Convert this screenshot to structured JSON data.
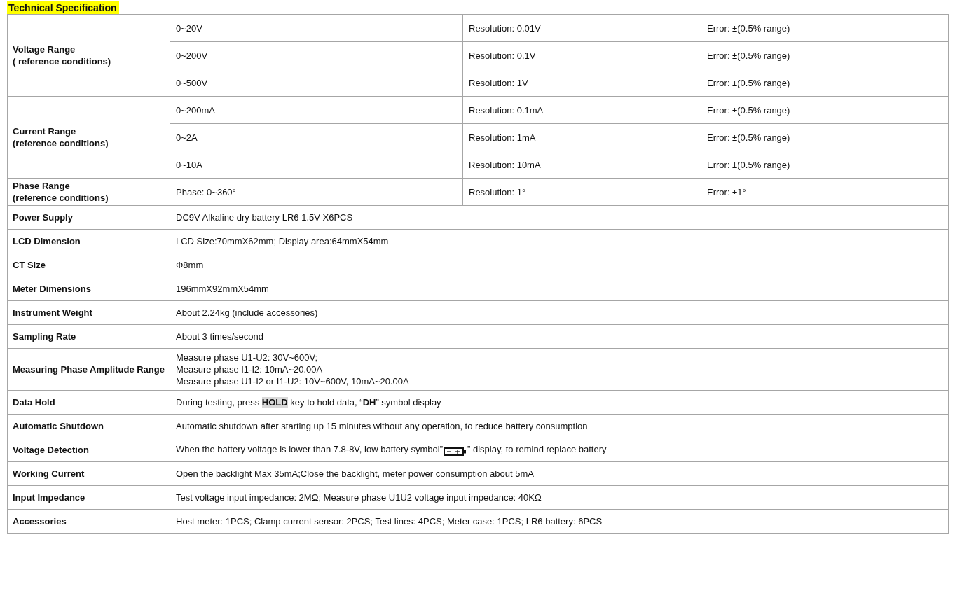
{
  "title": "Technical Specification",
  "rows": [
    {
      "kind": "ranges",
      "label": "Voltage Range\n( reference conditions)",
      "subrows": [
        {
          "range": "0~20V",
          "resolution": "Resolution: 0.01V",
          "error": "Error: ±(0.5% range)"
        },
        {
          "range": "0~200V",
          "resolution": "Resolution: 0.1V",
          "error": "Error: ±(0.5% range)"
        },
        {
          "range": "0~500V",
          "resolution": "Resolution: 1V",
          "error": "Error: ±(0.5% range)"
        }
      ]
    },
    {
      "kind": "ranges",
      "label": "Current Range\n(reference conditions)",
      "subrows": [
        {
          "range": "0~200mA",
          "resolution": "Resolution: 0.1mA",
          "error": "Error: ±(0.5% range)"
        },
        {
          "range": "0~2A",
          "resolution": "Resolution: 1mA",
          "error": "Error: ±(0.5% range)"
        },
        {
          "range": "0~10A",
          "resolution": "Resolution: 10mA",
          "error": "Error: ±(0.5% range)"
        }
      ]
    },
    {
      "kind": "ranges",
      "label": "Phase Range\n(reference conditions)",
      "subrows": [
        {
          "range": "Phase: 0~360°",
          "resolution": "Resolution: 1°",
          "error": "Error: ±1°"
        }
      ]
    },
    {
      "kind": "text",
      "label": "Power Supply",
      "value": "DC9V Alkaline dry battery LR6 1.5V X6PCS"
    },
    {
      "kind": "text",
      "label": "LCD Dimension",
      "value": "LCD Size:70mmX62mm; Display area:64mmX54mm"
    },
    {
      "kind": "text",
      "label": "CT Size",
      "value": "Φ8mm"
    },
    {
      "kind": "text",
      "label": "Meter Dimensions",
      "value": "196mmX92mmX54mm"
    },
    {
      "kind": "text",
      "label": "Instrument Weight",
      "value": "About 2.24kg (include accessories)"
    },
    {
      "kind": "text",
      "label": "Sampling Rate",
      "value": "About 3 times/second"
    },
    {
      "kind": "lines",
      "label": "Measuring Phase Amplitude Range",
      "lines": [
        "Measure phase U1-U2: 30V~600V;",
        "Measure phase I1-I2: 10mA~20.00A",
        "Measure phase U1-I2 or I1-U2: 10V~600V, 10mA~20.00A"
      ]
    },
    {
      "kind": "parts",
      "label": "Data Hold",
      "parts": [
        {
          "kind": "plain",
          "text": "During testing, press "
        },
        {
          "kind": "key",
          "text": "HOLD"
        },
        {
          "kind": "plain",
          "text": " key to hold data, “"
        },
        {
          "kind": "bold",
          "text": "DH"
        },
        {
          "kind": "plain",
          "text": "” symbol display"
        }
      ]
    },
    {
      "kind": "text",
      "label": "Automatic Shutdown",
      "value": "Automatic shutdown after starting up 15 minutes without any operation, to reduce battery consumption"
    },
    {
      "kind": "battery",
      "label": "Voltage Detection",
      "text_before": "When the battery voltage is lower than 7.8-8V, low battery symbol”",
      "text_after": "” display, to remind replace battery"
    },
    {
      "kind": "text",
      "label": "Working Current",
      "value": "Open the backlight Max 35mA;Close the backlight, meter power consumption about 5mA"
    },
    {
      "kind": "text",
      "label": "Input Impedance",
      "value": "Test voltage input impedance: 2MΩ; Measure phase U1U2 voltage input impedance: 40KΩ"
    },
    {
      "kind": "text",
      "label": "Accessories",
      "value": "Host meter: 1PCS; Clamp current sensor: 2PCS; Test lines: 4PCS; Meter case: 1PCS; LR6 battery: 6PCS"
    }
  ]
}
